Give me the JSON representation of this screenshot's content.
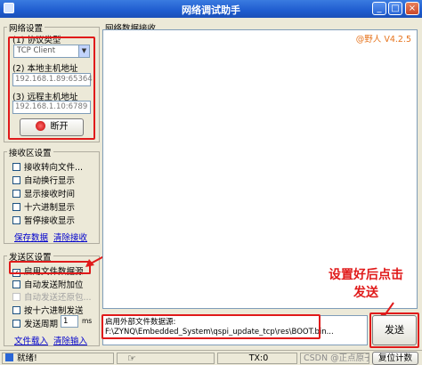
{
  "window": {
    "title": "网络调试助手",
    "minimize": "_",
    "maximize": "□",
    "close": "×"
  },
  "network_settings": {
    "legend": "网络设置",
    "protocol_label": "(1) 协议类型",
    "protocol_value": "TCP Client",
    "local_host_label": "(2) 本地主机地址",
    "local_host_value": "192.168.1.89:65364",
    "remote_host_label": "(3) 远程主机地址",
    "remote_host_value": "192.168.1.10:6789",
    "disconnect_button": "断开"
  },
  "receive_settings": {
    "legend": "接收区设置",
    "options": [
      "接收转向文件...",
      "自动换行显示",
      "显示接收时间",
      "十六进制显示",
      "暂停接收显示"
    ],
    "save_link": "保存数据",
    "clear_link": "清除接收"
  },
  "send_settings": {
    "legend": "发送区设置",
    "options": [
      {
        "label": "启用文件数据源...",
        "checked": "✓",
        "disabled": false
      },
      {
        "label": "自动发送附加位",
        "checked": "",
        "disabled": false
      },
      {
        "label": "自动发送还原包...",
        "checked": "",
        "disabled": true
      },
      {
        "label": "按十六进制发送",
        "checked": "",
        "disabled": false
      }
    ],
    "period_label": "发送周期",
    "period_value": "1",
    "period_unit": "ms",
    "file_load_link": "文件载入",
    "clear_input_link": "清除输入"
  },
  "receive_area": {
    "label": "网络数据接收",
    "version": "@野人 V4.2.5"
  },
  "send_area": {
    "line1": "启用外部文件数据源:",
    "line2": "F:\\ZYNQ\\Embedded_System\\qspi_update_tcp\\res\\BOOT.bin..."
  },
  "send_button": "发送",
  "annotation": "设置好后点击\n发送",
  "status": {
    "ready": "就绪!",
    "tx_label": "TX:0",
    "reset": "复位计数",
    "watermark": "CSDN @正点原子"
  }
}
